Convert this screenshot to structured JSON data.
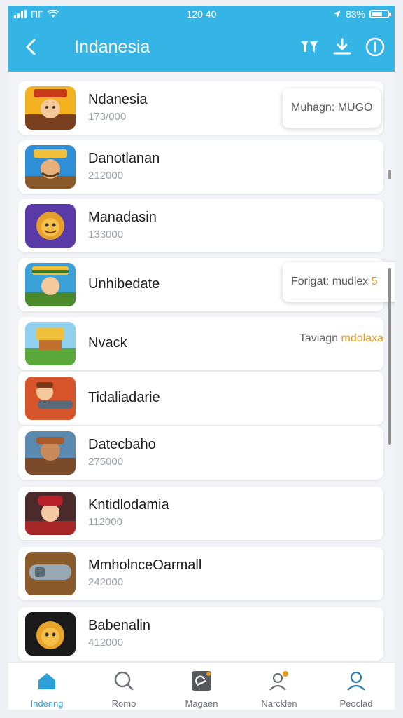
{
  "status_bar": {
    "left": "ΠΓ",
    "time": "120 40",
    "battery": "83%"
  },
  "header": {
    "title": "Indanesia"
  },
  "apps": [
    {
      "name": "Ndanesia",
      "number": "173/000"
    },
    {
      "name": "Danotlanan",
      "number": "212000"
    },
    {
      "name": "Manadasin",
      "number": "133000"
    },
    {
      "name": "Unhibedate",
      "number": ""
    },
    {
      "name": "Nvack",
      "number": ""
    },
    {
      "name": "Tidaliadarie",
      "number": ""
    },
    {
      "name": "Datecbaho",
      "number": "275000"
    },
    {
      "name": "Kntidlodamia",
      "number": "112000"
    },
    {
      "name": "MmholnceOarmall",
      "number": "242000"
    },
    {
      "name": "Babenalin",
      "number": "412000"
    }
  ],
  "popups": {
    "first": "Muhagn: MUGO",
    "second": "Forigat: mudlex",
    "second_badge": "5",
    "third_prefix": "Taviagn",
    "third_highlight": "mdolaxa"
  },
  "tabs": [
    {
      "label": "Indenng",
      "icon": "home-icon"
    },
    {
      "label": "Romo",
      "icon": "search-icon"
    },
    {
      "label": "Magaen",
      "icon": "gallery-icon"
    },
    {
      "label": "Narcklen",
      "icon": "contacts-icon"
    },
    {
      "label": "Peoclad",
      "icon": "profile-icon"
    }
  ],
  "colors": {
    "primary": "#35b4e6",
    "active_tab": "#2b9fd6",
    "accent_orange": "#e89a1f"
  }
}
